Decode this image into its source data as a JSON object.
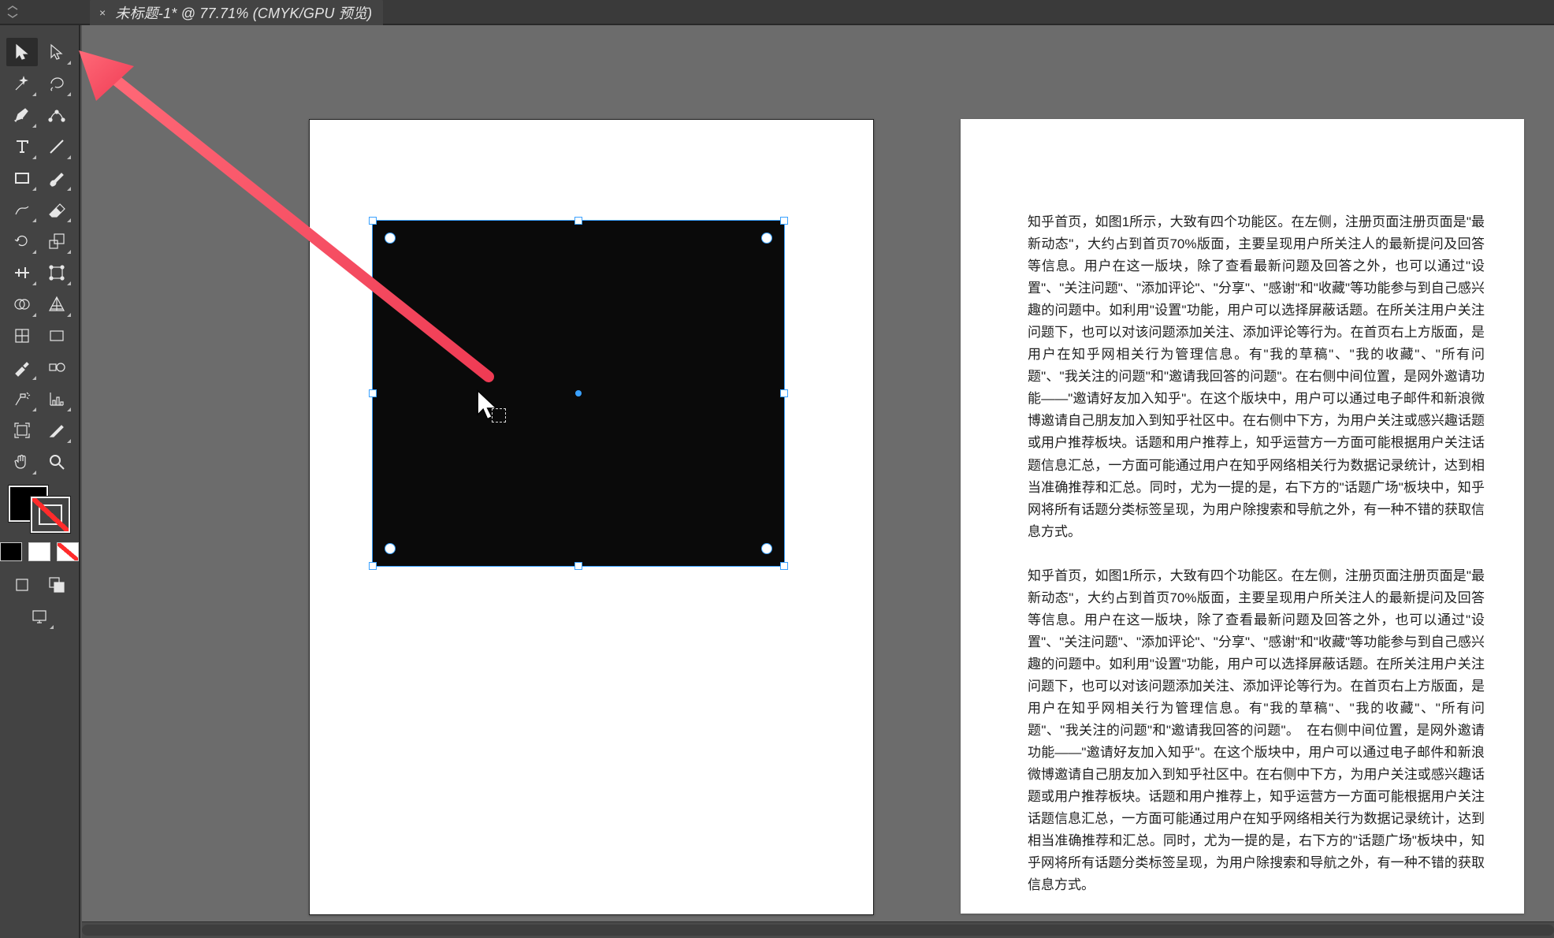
{
  "tab": {
    "close_label": "×",
    "title": "未标题-1* @ 77.71% (CMYK/GPU 预览)"
  },
  "tools": {
    "row0": [
      "selection-tool",
      "direct-selection-tool"
    ],
    "row1": [
      "magic-wand-tool",
      "lasso-tool"
    ],
    "row2": [
      "pen-tool",
      "curvature-tool"
    ],
    "row3": [
      "type-tool",
      "line-segment-tool"
    ],
    "row4": [
      "rectangle-tool",
      "paintbrush-tool"
    ],
    "row5": [
      "shaper-tool",
      "eraser-tool"
    ],
    "row6": [
      "rotate-tool",
      "scale-tool"
    ],
    "row7": [
      "width-tool",
      "free-transform-tool"
    ],
    "row8": [
      "shape-builder-tool",
      "perspective-grid-tool"
    ],
    "row9": [
      "mesh-tool",
      "gradient-tool"
    ],
    "row10": [
      "eyedropper-tool",
      "blend-tool"
    ],
    "row11": [
      "symbol-sprayer-tool",
      "column-graph-tool"
    ],
    "row12": [
      "artboard-tool",
      "slice-tool"
    ],
    "row13": [
      "hand-tool",
      "zoom-tool"
    ]
  },
  "swatches": {
    "fill_color": "#000000",
    "stroke_state": "none"
  },
  "artboards": {
    "zoom_percent": 77.71,
    "paragraph1": "知乎首页，如图1所示，大致有四个功能区。在左侧，注册页面注册页面是\"最新动态\"，大约占到首页70%版面，主要呈现用户所关注人的最新提问及回答等信息。用户在这一版块，除了查看最新问题及回答之外，也可以通过\"设置\"、\"关注问题\"、\"添加评论\"、\"分享\"、\"感谢\"和\"收藏\"等功能参与到自己感兴趣的问题中。如利用\"设置\"功能，用户可以选择屏蔽话题。在所关注用户关注问题下，也可以对该问题添加关注、添加评论等行为。在首页右上方版面，是用户在知乎网相关行为管理信息。有\"我的草稿\"、\"我的收藏\"、\"所有问题\"、\"我关注的问题\"和\"邀请我回答的问题\"。在右侧中间位置，是网外邀请功能——\"邀请好友加入知乎\"。在这个版块中，用户可以通过电子邮件和新浪微博邀请自己朋友加入到知乎社区中。在右侧中下方，为用户关注或感兴趣话题或用户推荐板块。话题和用户推荐上，知乎运营方一方面可能根据用户关注话题信息汇总，一方面可能通过用户在知乎网络相关行为数据记录统计，达到相当准确推荐和汇总。同时，尤为一提的是，右下方的\"话题广场\"板块中，知乎网将所有话题分类标签呈现，为用户除搜索和导航之外，有一种不错的获取信息方式。",
    "paragraph2": "知乎首页，如图1所示，大致有四个功能区。在左侧，注册页面注册页面是\"最新动态\"，大约占到首页70%版面，主要呈现用户所关注人的最新提问及回答等信息。用户在这一版块，除了查看最新问题及回答之外，也可以通过\"设置\"、\"关注问题\"、\"添加评论\"、\"分享\"、\"感谢\"和\"收藏\"等功能参与到自己感兴趣的问题中。如利用\"设置\"功能，用户可以选择屏蔽话题。在所关注用户关注问题下，也可以对该问题添加关注、添加评论等行为。在首页右上方版面，是用户在知乎网相关行为管理信息。有\"我的草稿\"、\"我的收藏\"、\"所有问题\"、\"我关注的问题\"和\"邀请我回答的问题\"。　在右侧中间位置，是网外邀请功能——\"邀请好友加入知乎\"。在这个版块中，用户可以通过电子邮件和新浪微博邀请自己朋友加入到知乎社区中。在右侧中下方，为用户关注或感兴趣话题或用户推荐板块。话题和用户推荐上，知乎运营方一方面可能根据用户关注话题信息汇总，一方面可能通过用户在知乎网络相关行为数据记录统计，达到相当准确推荐和汇总。同时，尤为一提的是，右下方的\"话题广场\"板块中，知乎网将所有话题分类标签呈现，为用户除搜索和导航之外，有一种不错的获取信息方式。"
  }
}
